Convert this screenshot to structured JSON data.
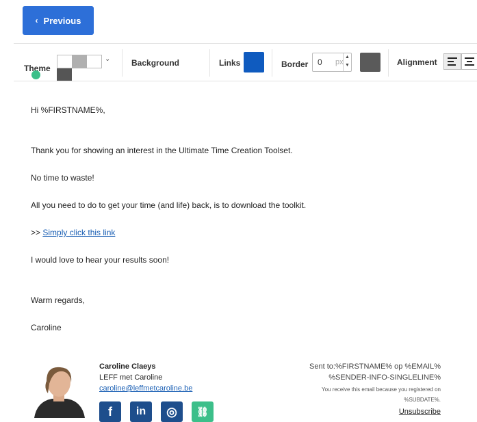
{
  "nav": {
    "previous_label": "Previous"
  },
  "toolbar": {
    "theme_label": "Theme",
    "background_label": "Background",
    "links_label": "Links",
    "border_label": "Border",
    "border_value": "0",
    "border_unit": "px",
    "alignment_label": "Alignment",
    "colors": {
      "links": "#0f5bbf",
      "border": "#5a5a5a"
    }
  },
  "email": {
    "greeting": "Hi %FIRSTNAME%,",
    "para1": "Thank you for showing an interest in the Ultimate Time Creation Toolset.",
    "para2": "No time to waste!",
    "para3": "All you need to do to get your time (and life) back, is to download the toolkit.",
    "link_prefix": ">>",
    "link_text": "Simply click this link",
    "para4": "I would love to hear your results soon!",
    "closing": "Warm regards,",
    "signoff": "Caroline"
  },
  "signature": {
    "name": "Caroline Claeys",
    "company": "LEFF met Caroline",
    "email": "caroline@leffmetcaroline.be",
    "social": [
      {
        "icon": "facebook-icon",
        "glyph": "f",
        "color": "#1e4e8c"
      },
      {
        "icon": "linkedin-icon",
        "glyph": "in",
        "color": "#1e4e8c"
      },
      {
        "icon": "instagram-icon",
        "glyph": "◎",
        "color": "#1e4e8c"
      },
      {
        "icon": "link-icon",
        "glyph": "⛓",
        "color": "#3cbf8a"
      }
    ]
  },
  "footer": {
    "sent_to": "Sent to:%FIRSTNAME% op %EMAIL%",
    "sender_info": "%SENDER-INFO-SINGLELINE%",
    "reason": "You receive this email because you registered on",
    "subdate": "%SUBDATE%.",
    "unsubscribe": "Unsubscribe"
  }
}
